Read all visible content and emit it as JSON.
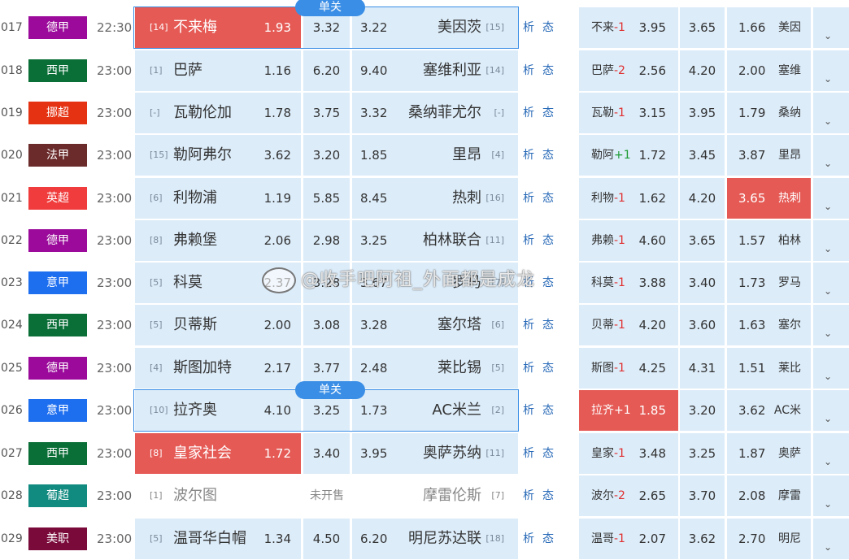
{
  "badge_label": "单关",
  "links": {
    "analysis": "析",
    "trend": "态"
  },
  "presale_label": "未开售",
  "watermark_text": "@收手吧阿祖_外面都是成龙",
  "colors": {
    "cell_bg": "#dcecf9",
    "highlight": "#e55a55",
    "badge": "#3a8ee6"
  },
  "matches": [
    {
      "num": "017",
      "league": "德甲",
      "league_color": "#9b0a9b",
      "time": "22:30",
      "home_rank": "[14]",
      "home": "不来梅",
      "home_odd": "1.93",
      "draw_odd": "3.32",
      "away_odd": "3.22",
      "away": "美因茨",
      "away_rank": "[15]",
      "hcp_team": "不来",
      "hcp": "-1",
      "hcp_home": "3.95",
      "hcp_draw": "3.65",
      "hcp_away": "1.66",
      "away_abbr": "美因"
    },
    {
      "num": "018",
      "league": "西甲",
      "league_color": "#0a6e37",
      "time": "23:00",
      "home_rank": "[1]",
      "home": "巴萨",
      "home_odd": "1.16",
      "draw_odd": "6.20",
      "away_odd": "9.40",
      "away": "塞维利亚",
      "away_rank": "[14]",
      "hcp_team": "巴萨",
      "hcp": "-2",
      "hcp_home": "2.56",
      "hcp_draw": "4.20",
      "hcp_away": "2.00",
      "away_abbr": "塞维"
    },
    {
      "num": "019",
      "league": "挪超",
      "league_color": "#e53212",
      "time": "23:00",
      "home_rank": "[-]",
      "home": "瓦勒伦加",
      "home_odd": "1.78",
      "draw_odd": "3.75",
      "away_odd": "3.32",
      "away": "桑纳菲尤尔",
      "away_rank": "[-]",
      "hcp_team": "瓦勒",
      "hcp": "-1",
      "hcp_home": "3.15",
      "hcp_draw": "3.95",
      "hcp_away": "1.79",
      "away_abbr": "桑纳"
    },
    {
      "num": "020",
      "league": "法甲",
      "league_color": "#6b2b2b",
      "time": "23:00",
      "home_rank": "[15]",
      "home": "勒阿弗尔",
      "home_odd": "3.62",
      "draw_odd": "3.20",
      "away_odd": "1.85",
      "away": "里昂",
      "away_rank": "[4]",
      "hcp_team": "勒阿",
      "hcp": "+1",
      "hcp_home": "1.72",
      "hcp_draw": "3.45",
      "hcp_away": "3.87",
      "away_abbr": "里昂"
    },
    {
      "num": "021",
      "league": "英超",
      "league_color": "#f03c3c",
      "time": "23:00",
      "home_rank": "[6]",
      "home": "利物浦",
      "home_odd": "1.19",
      "draw_odd": "5.85",
      "away_odd": "8.45",
      "away": "热刺",
      "away_rank": "[16]",
      "hcp_team": "利物",
      "hcp": "-1",
      "hcp_home": "1.62",
      "hcp_draw": "4.20",
      "hcp_away": "3.65",
      "away_abbr": "热刺"
    },
    {
      "num": "022",
      "league": "德甲",
      "league_color": "#9b0a9b",
      "time": "23:00",
      "home_rank": "[8]",
      "home": "弗赖堡",
      "home_odd": "2.06",
      "draw_odd": "2.98",
      "away_odd": "3.25",
      "away": "柏林联合",
      "away_rank": "[11]",
      "hcp_team": "弗赖",
      "hcp": "-1",
      "hcp_home": "4.60",
      "hcp_draw": "3.65",
      "hcp_away": "1.57",
      "away_abbr": "柏林"
    },
    {
      "num": "023",
      "league": "意甲",
      "league_color": "#1e6ff0",
      "time": "23:00",
      "home_rank": "[5]",
      "home": "科莫",
      "home_odd": "2.37",
      "draw_odd": "3.28",
      "away_odd": "3.67",
      "away": "罗马",
      "away_rank": "[7]",
      "hcp_team": "科莫",
      "hcp": "-1",
      "hcp_home": "3.88",
      "hcp_draw": "3.40",
      "hcp_away": "1.73",
      "away_abbr": "罗马"
    },
    {
      "num": "024",
      "league": "西甲",
      "league_color": "#0a6e37",
      "time": "23:00",
      "home_rank": "[5]",
      "home": "贝蒂斯",
      "home_odd": "2.00",
      "draw_odd": "3.08",
      "away_odd": "3.28",
      "away": "塞尔塔",
      "away_rank": "[6]",
      "hcp_team": "贝蒂",
      "hcp": "-1",
      "hcp_home": "4.20",
      "hcp_draw": "3.60",
      "hcp_away": "1.63",
      "away_abbr": "塞尔"
    },
    {
      "num": "025",
      "league": "德甲",
      "league_color": "#9b0a9b",
      "time": "23:00",
      "home_rank": "[4]",
      "home": "斯图加特",
      "home_odd": "2.17",
      "draw_odd": "3.77",
      "away_odd": "2.48",
      "away": "莱比锡",
      "away_rank": "[5]",
      "hcp_team": "斯图",
      "hcp": "-1",
      "hcp_home": "4.25",
      "hcp_draw": "4.31",
      "hcp_away": "1.51",
      "away_abbr": "莱比"
    },
    {
      "num": "026",
      "league": "意甲",
      "league_color": "#1e6ff0",
      "time": "23:00",
      "home_rank": "[10]",
      "home": "拉齐奥",
      "home_odd": "4.10",
      "draw_odd": "3.25",
      "away_odd": "1.73",
      "away": "AC米兰",
      "away_rank": "[2]",
      "hcp_team": "拉齐",
      "hcp": "+1",
      "hcp_home": "1.85",
      "hcp_draw": "3.20",
      "hcp_away": "3.62",
      "away_abbr": "AC米"
    },
    {
      "num": "027",
      "league": "西甲",
      "league_color": "#0a6e37",
      "time": "23:00",
      "home_rank": "[8]",
      "home": "皇家社会",
      "home_odd": "1.72",
      "draw_odd": "3.40",
      "away_odd": "3.95",
      "away": "奥萨苏纳",
      "away_rank": "[11]",
      "hcp_team": "皇家",
      "hcp": "-1",
      "hcp_home": "3.48",
      "hcp_draw": "3.25",
      "hcp_away": "1.87",
      "away_abbr": "奥萨"
    },
    {
      "num": "028",
      "league": "葡超",
      "league_color": "#118a80",
      "time": "23:00",
      "home_rank": "[1]",
      "home": "波尔图",
      "home_odd": "",
      "draw_odd": "",
      "away_odd": "",
      "away": "摩雷伦斯",
      "away_rank": "[7]",
      "hcp_team": "波尔",
      "hcp": "-2",
      "hcp_home": "2.65",
      "hcp_draw": "3.70",
      "hcp_away": "2.08",
      "away_abbr": "摩雷"
    },
    {
      "num": "029",
      "league": "美职",
      "league_color": "#7a0a3a",
      "time": "23:00",
      "home_rank": "[5]",
      "home": "温哥华白帽",
      "home_odd": "1.34",
      "draw_odd": "4.50",
      "away_odd": "6.20",
      "away": "明尼苏达联",
      "away_rank": "[18]",
      "hcp_team": "温哥",
      "hcp": "-1",
      "hcp_home": "2.07",
      "hcp_draw": "3.62",
      "hcp_away": "2.70",
      "away_abbr": "明尼"
    }
  ]
}
